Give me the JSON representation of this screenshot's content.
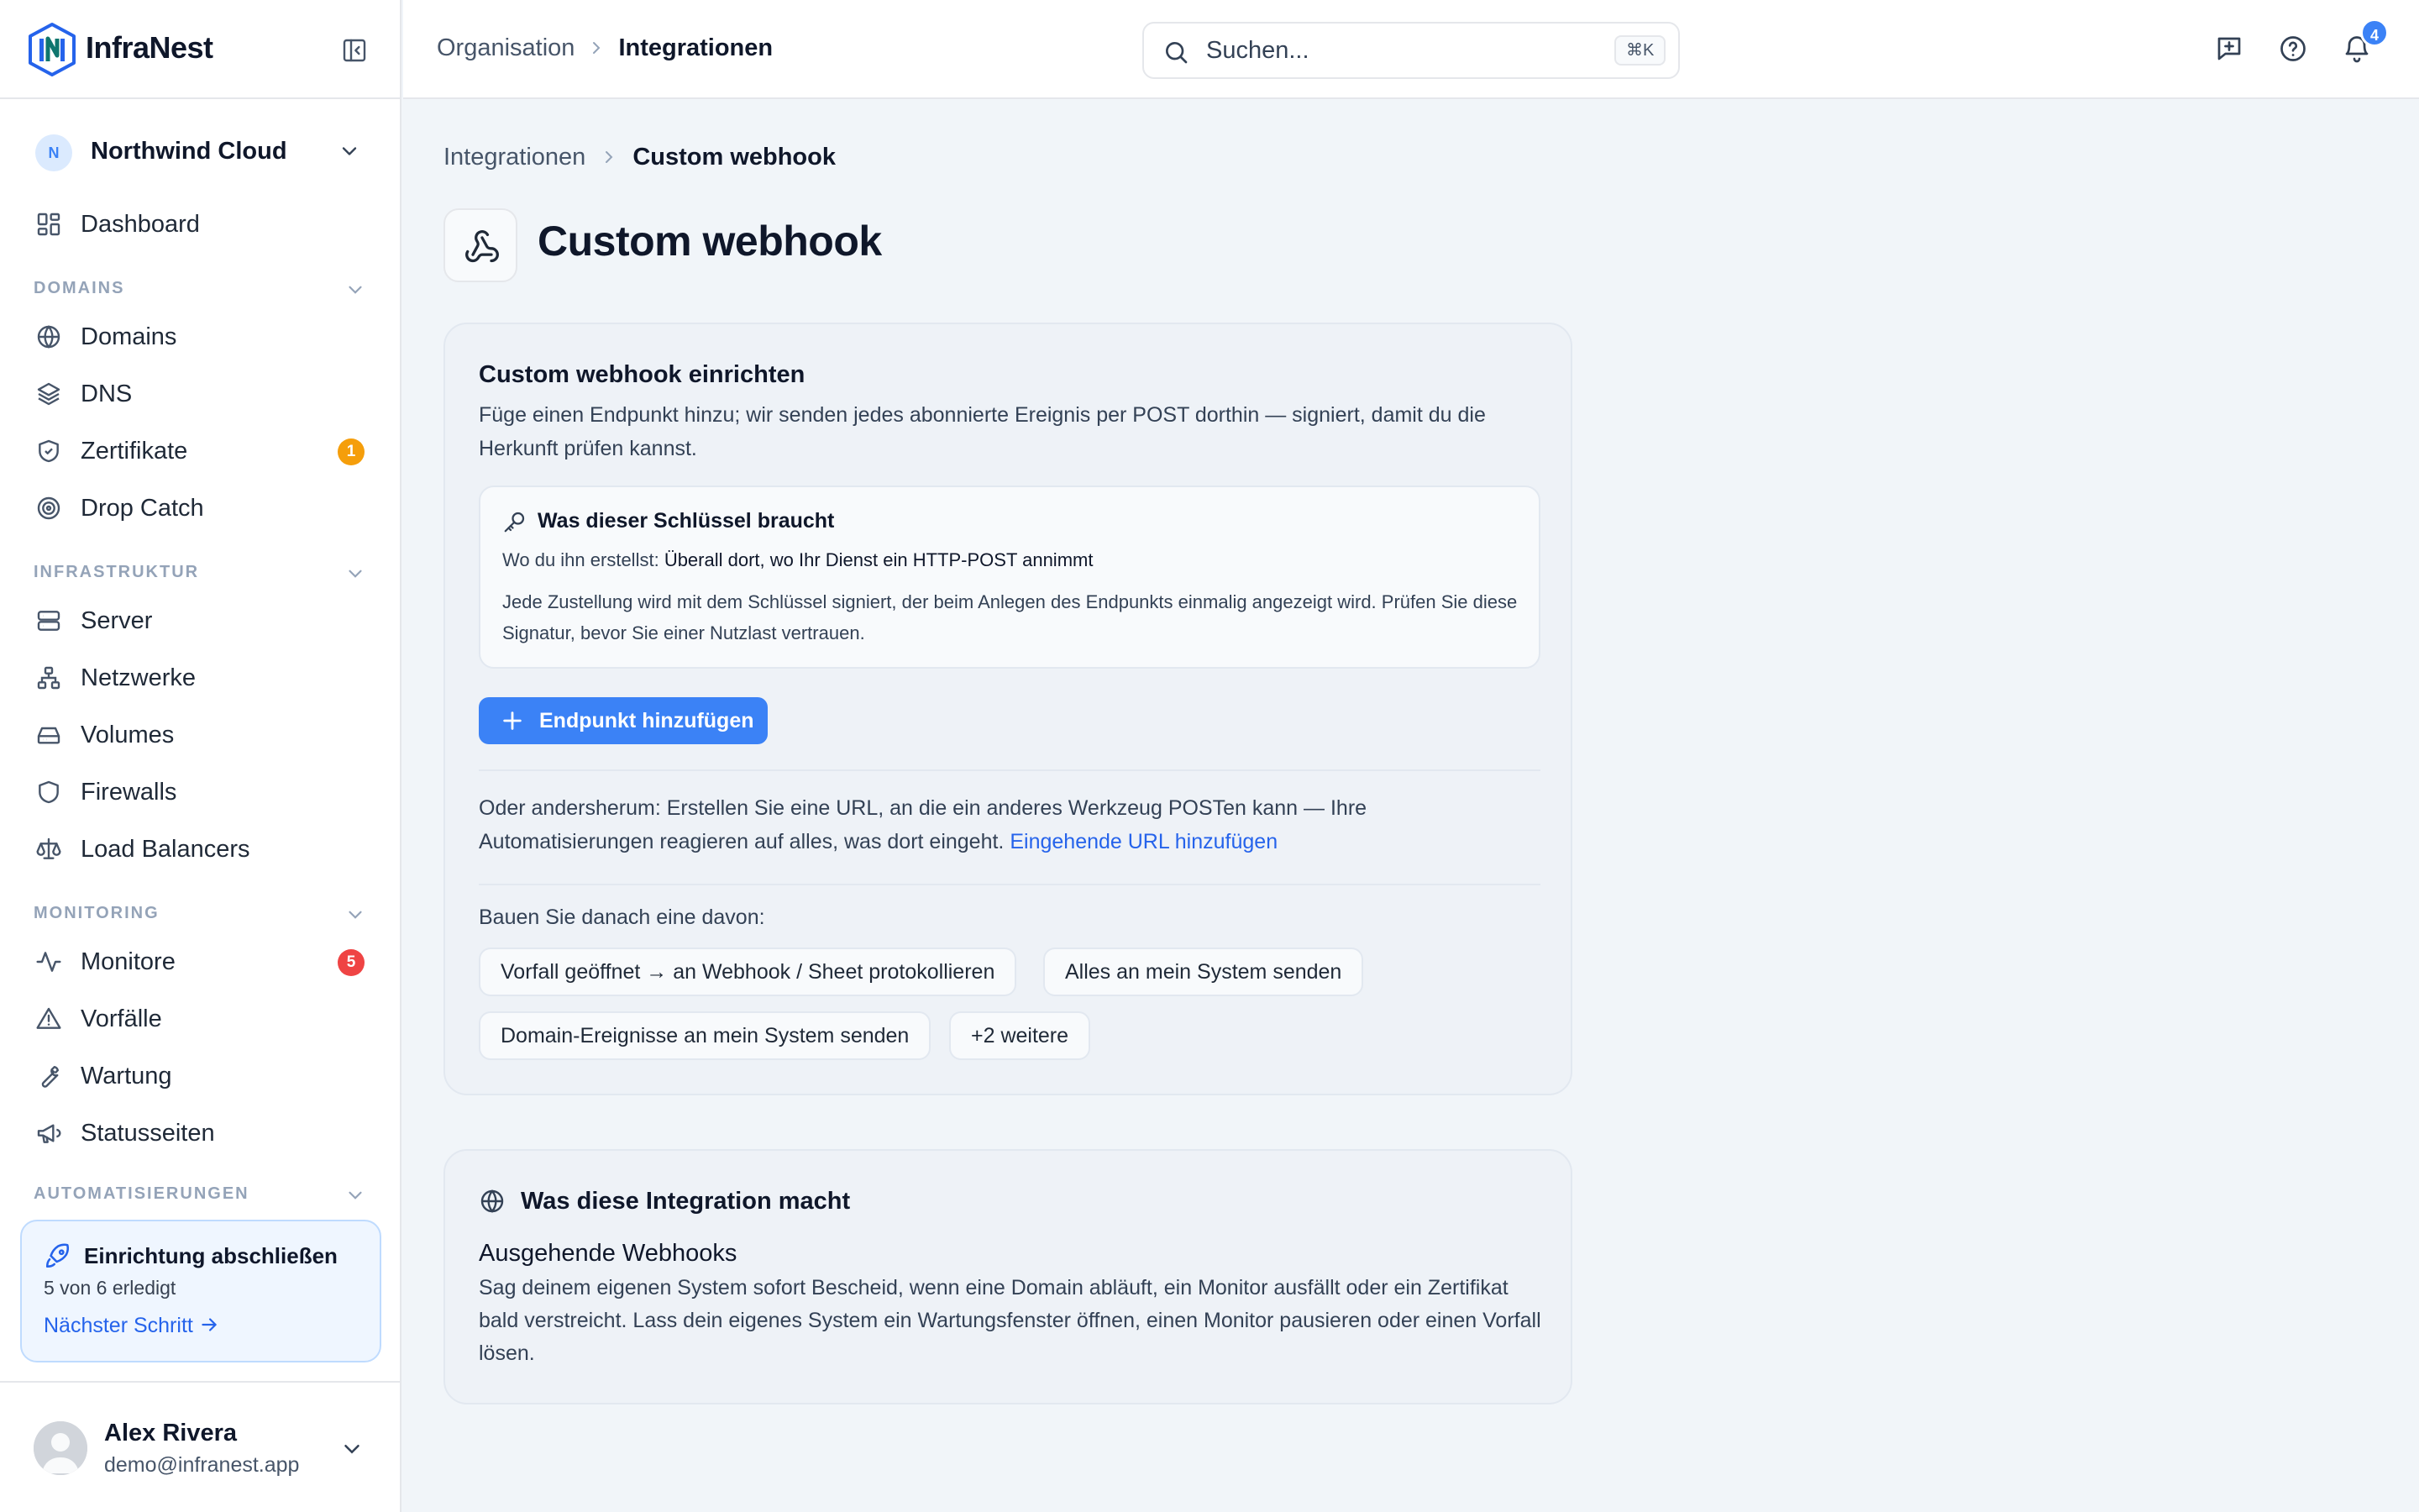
{
  "brand": {
    "name": "InfraNest"
  },
  "org": {
    "initial": "N",
    "name": "Northwind Cloud"
  },
  "nav": {
    "dashboard": "Dashboard",
    "sections": {
      "domains": "DOMAINS",
      "infrastruktur": "INFRASTRUKTUR",
      "monitoring": "MONITORING",
      "automatisierungen": "AUTOMATISIERUNGEN"
    },
    "items": {
      "domains": "Domains",
      "dns": "DNS",
      "zertifikate": "Zertifikate",
      "dropcatch": "Drop Catch",
      "server": "Server",
      "netzwerke": "Netzwerke",
      "volumes": "Volumes",
      "firewalls": "Firewalls",
      "loadbalancers": "Load Balancers",
      "monitore": "Monitore",
      "vorfaelle": "Vorfälle",
      "wartung": "Wartung",
      "statusseiten": "Statusseiten"
    },
    "badges": {
      "zertifikate": "1",
      "monitore": "5"
    },
    "badge_colors": {
      "warning": "#f59e0b",
      "danger": "#ef4444"
    }
  },
  "setup": {
    "title": "Einrichtung abschließen",
    "progress": "5 von 6 erledigt",
    "link": "Nächster Schritt"
  },
  "user": {
    "name": "Alex Rivera",
    "email": "demo@infranest.app"
  },
  "topbar": {
    "breadcrumb": [
      "Organisation",
      "Integrationen"
    ],
    "search_placeholder": "Suchen...",
    "search_shortcut": "⌘K",
    "notifications_count": "4"
  },
  "page": {
    "breadcrumb": [
      "Integrationen",
      "Custom webhook"
    ],
    "title": "Custom webhook"
  },
  "setup_card": {
    "title": "Custom webhook einrichten",
    "description": "Füge einen Endpunkt hinzu; wir senden jedes abonnierte Ereignis per POST dorthin — signiert, damit du die Herkunft prüfen kannst.",
    "key": {
      "title": "Was dieser Schlüssel braucht",
      "where_label": "Wo du ihn erstellst:",
      "where_value": "Überall dort, wo Ihr Dienst ein HTTP-POST annimmt",
      "note": "Jede Zustellung wird mit dem Schlüssel signiert, der beim Anlegen des Endpunkts einmalig angezeigt wird. Prüfen Sie diese Signatur, bevor Sie einer Nutzlast vertrauen."
    },
    "add_button": "Endpunkt hinzufügen",
    "alt_text": "Oder andersherum: Erstellen Sie eine URL, an die ein anderes Werkzeug POSTen kann — Ihre Automatisierungen reagieren auf alles, was dort eingeht.",
    "alt_link": "Eingehende URL hinzufügen",
    "build_label": "Bauen Sie danach eine davon:",
    "recipes": [
      "Vorfall geöffnet → an Webhook / Sheet protokollieren",
      "Alles an mein System senden",
      "Domain-Ereignisse an mein System senden",
      "+2 weitere"
    ]
  },
  "info_card": {
    "title": "Was diese Integration macht",
    "subtitle": "Ausgehende Webhooks",
    "description": "Sag deinem eigenen System sofort Bescheid, wenn eine Domain abläuft, ein Monitor ausfällt oder ein Zertifikat bald verstreicht. Lass dein eigenes System ein Wartungsfenster öffnen, einen Monitor pausieren oder einen Vorfall lösen."
  },
  "colors": {
    "accent": "#3b82f6",
    "link": "#2563eb"
  }
}
